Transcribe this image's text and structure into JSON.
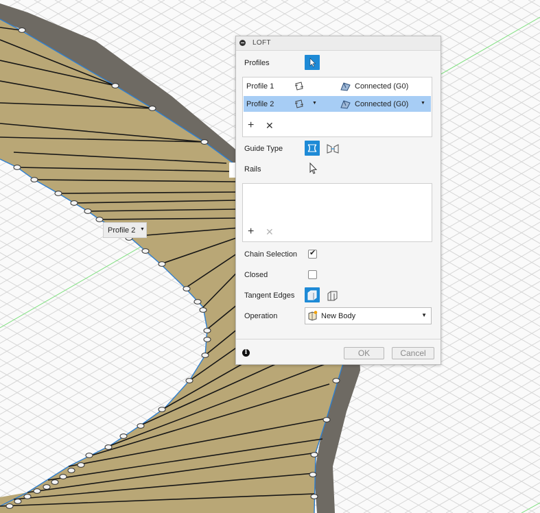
{
  "dialog": {
    "title": "LOFT",
    "profiles_label": "Profiles",
    "profiles_list": [
      {
        "name": "Profile 1",
        "condition": "Connected (G0)",
        "selected": false
      },
      {
        "name": "Profile 2",
        "condition": "Connected (G0)",
        "selected": true
      }
    ],
    "guide_type_label": "Guide Type",
    "rails_label": "Rails",
    "chain_selection_label": "Chain Selection",
    "chain_selection_checked": true,
    "closed_label": "Closed",
    "closed_checked": false,
    "tangent_edges_label": "Tangent Edges",
    "operation_label": "Operation",
    "operation_value": "New Body",
    "ok_label": "OK",
    "cancel_label": "Cancel"
  },
  "canvas_label": {
    "text": "Profile 2"
  },
  "colors": {
    "accent": "#1e8ad6",
    "selected_row": "#a7cdf5",
    "surface": "#b9a776",
    "rim": "#6e6a63",
    "annotation": "#d01818",
    "grid": "#d4d4d4",
    "axis": "#7fe07f"
  },
  "icons": {
    "collapse": "minus-circle-icon",
    "select": "cursor-arrow-icon",
    "loft_profile": "profile-loop-icon",
    "connected": "connected-g0-icon",
    "add": "plus-icon",
    "remove": "x-icon",
    "guide_rails": "guide-rails-icon",
    "guide_centerline": "guide-centerline-icon",
    "tangent_merge": "tangent-merge-icon",
    "tangent_keep": "tangent-keep-icon",
    "new_body": "new-body-icon",
    "info": "info-icon"
  }
}
